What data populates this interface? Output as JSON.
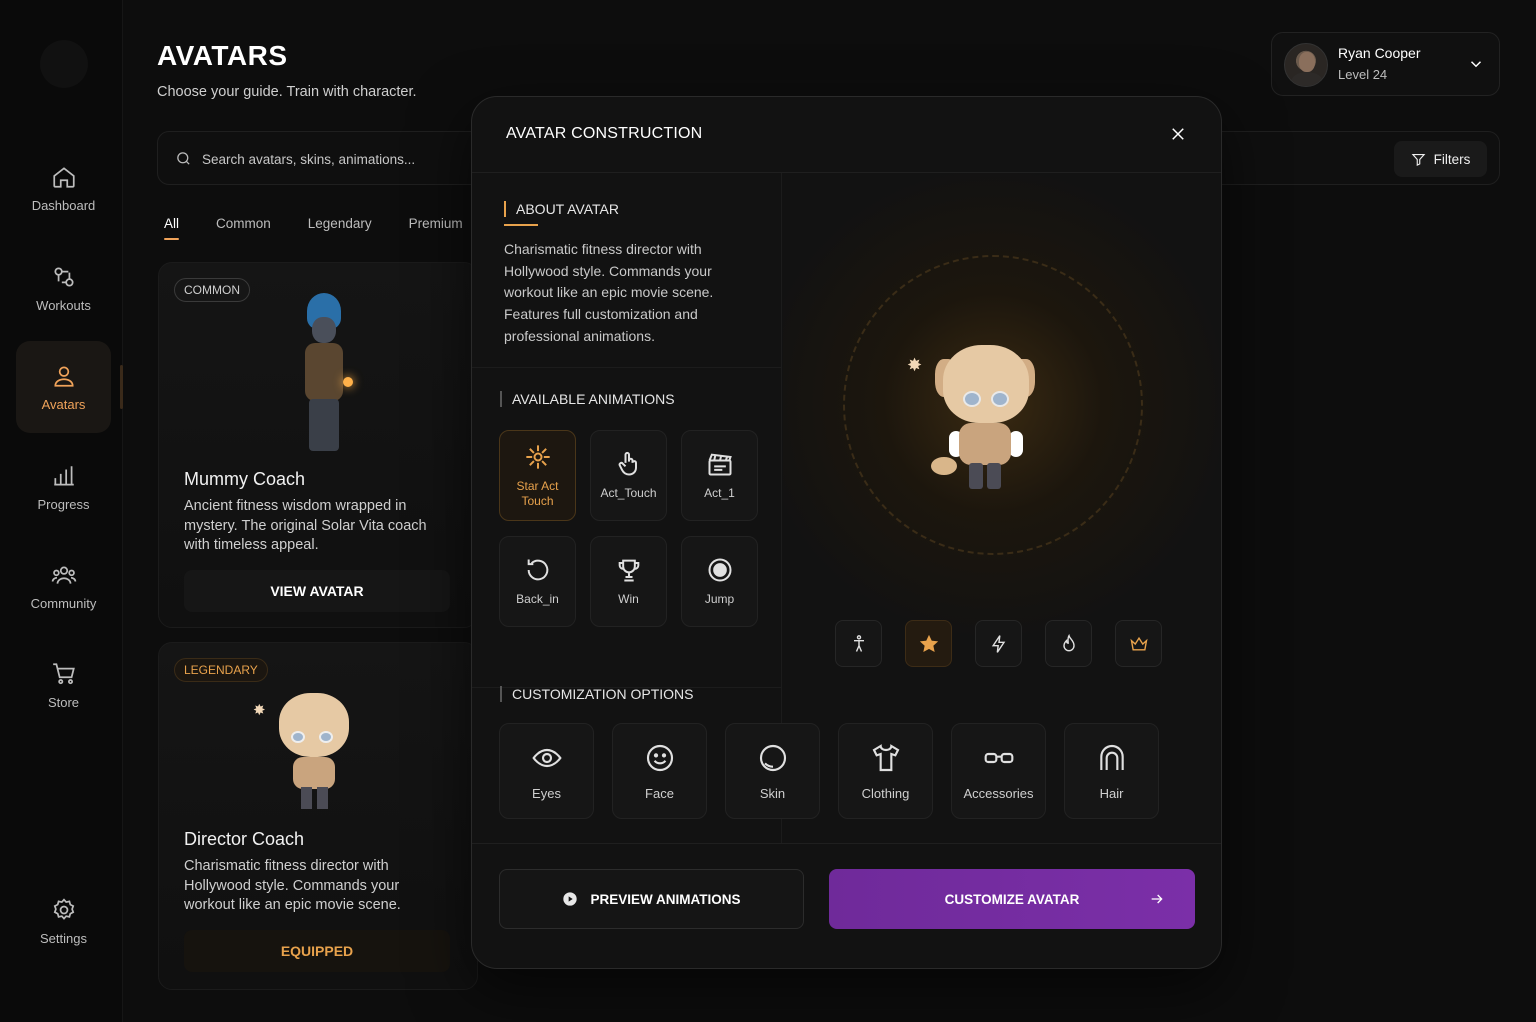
{
  "page": {
    "title": "AVATARS",
    "subtitle": "Choose your guide. Train with character."
  },
  "sidebar": {
    "items": [
      {
        "label": "Dashboard",
        "icon": "home-icon"
      },
      {
        "label": "Workouts",
        "icon": "workouts-icon"
      },
      {
        "label": "Avatars",
        "icon": "user-icon",
        "active": true
      },
      {
        "label": "Progress",
        "icon": "chart-icon"
      },
      {
        "label": "Community",
        "icon": "users-icon"
      },
      {
        "label": "Store",
        "icon": "cart-icon"
      },
      {
        "label": "Settings",
        "icon": "gear-icon"
      }
    ]
  },
  "user": {
    "name": "Ryan Cooper",
    "level": "Level 24"
  },
  "search": {
    "placeholder": "Search avatars, skins, animations..."
  },
  "filters_label": "Filters",
  "tabs": [
    "All",
    "Common",
    "Legendary",
    "Premium"
  ],
  "cards": [
    {
      "badge": "COMMON",
      "title": "Mummy Coach",
      "description": "Ancient fitness wisdom wrapped in mystery. The original Solar Vita coach with timeless appeal.",
      "button": "VIEW AVATAR"
    },
    {
      "badge": "LEGENDARY",
      "title": "Director Coach",
      "description": "Charismatic fitness director with Hollywood style. Commands your workout like an epic movie scene.",
      "button": "EQUIPPED"
    }
  ],
  "modal": {
    "title": "AVATAR CONSTRUCTION",
    "about_label": "ABOUT AVATAR",
    "about_text": "Charismatic fitness director with Hollywood style. Commands your workout like an epic movie scene. Features full customization and professional animations.",
    "animations_label": "AVAILABLE ANIMATIONS",
    "animations": [
      {
        "label": "Star Act Touch",
        "icon": "sparkle-icon",
        "active": true
      },
      {
        "label": "Act_Touch",
        "icon": "hand-pointer-icon"
      },
      {
        "label": "Act_1",
        "icon": "clapperboard-icon"
      },
      {
        "label": "Back_in",
        "icon": "rotate-icon"
      },
      {
        "label": "Win",
        "icon": "trophy-icon"
      },
      {
        "label": "Jump",
        "icon": "record-icon"
      }
    ],
    "poses": [
      {
        "icon": "figure-icon"
      },
      {
        "icon": "star-icon",
        "active": true
      },
      {
        "icon": "bolt-icon"
      },
      {
        "icon": "flame-icon"
      },
      {
        "icon": "crown-icon"
      }
    ],
    "customization_label": "CUSTOMIZATION OPTIONS",
    "customization": [
      {
        "label": "Eyes",
        "icon": "eye-icon"
      },
      {
        "label": "Face",
        "icon": "smile-icon"
      },
      {
        "label": "Skin",
        "icon": "circle-icon"
      },
      {
        "label": "Clothing",
        "icon": "shirt-icon"
      },
      {
        "label": "Accessories",
        "icon": "glasses-icon"
      },
      {
        "label": "Hair",
        "icon": "hair-icon"
      }
    ],
    "preview_button": "PREVIEW ANIMATIONS",
    "customize_button": "CUSTOMIZE AVATAR"
  },
  "colors": {
    "accent_orange": "#e8a24c",
    "accent_purple": "#7b2fa8",
    "background": "#0d0d0d"
  }
}
